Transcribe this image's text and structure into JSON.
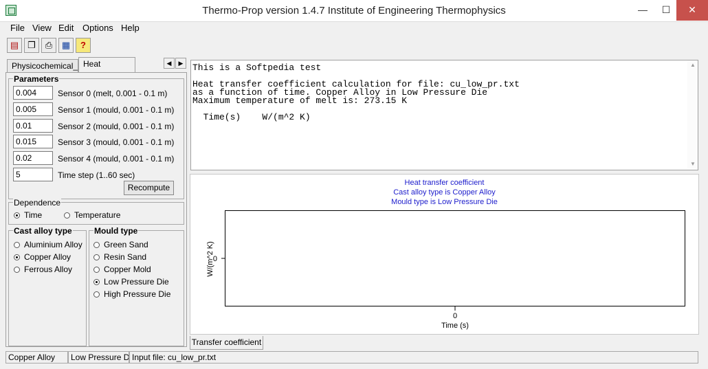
{
  "window": {
    "title": "Thermo-Prop version 1.4.7  Institute of Engineering Thermophysics",
    "minimize_glyph": "—",
    "maximize_glyph": "☐",
    "close_glyph": "✕"
  },
  "menu": [
    "File",
    "View",
    "Edit",
    "Options",
    "Help"
  ],
  "toolbar": {
    "icons": [
      "open-icon",
      "copy-icon",
      "print-icon",
      "table-icon",
      "help-icon"
    ],
    "glyphs": [
      "▤",
      "❐",
      "⎙",
      "▦",
      "?"
    ]
  },
  "tabs": {
    "left": [
      "Physicochemical_B",
      "Heat Transfer"
    ],
    "arrow_left": "◀",
    "arrow_right": "▶",
    "bottom": "Transfer coefficient"
  },
  "parameters": {
    "title": "Parameters",
    "fields": [
      {
        "value": "0.004",
        "label": "Sensor 0 (melt, 0.001 - 0.1 m)"
      },
      {
        "value": "0.005",
        "label": "Sensor 1 (mould, 0.001 - 0.1 m)"
      },
      {
        "value": "0.01",
        "label": "Sensor 2 (mould, 0.001 - 0.1 m)"
      },
      {
        "value": "0.015",
        "label": "Sensor 3 (mould, 0.001 - 0.1 m)"
      },
      {
        "value": "0.02",
        "label": "Sensor 4 (mould, 0.001 - 0.1 m)"
      },
      {
        "value": "5",
        "label": "Time step (1..60 sec)"
      }
    ],
    "recompute_label": "Recompute"
  },
  "dependence": {
    "title": "Dependence",
    "options": [
      "Time",
      "Temperature"
    ],
    "selected": 0
  },
  "cast_alloy": {
    "title": "Cast alloy type",
    "options": [
      "Aluminium Alloy",
      "Copper Alloy",
      "Ferrous Alloy"
    ],
    "selected": 1
  },
  "mould": {
    "title": "Mould type",
    "options": [
      "Green Sand",
      "Resin Sand",
      "Copper Mold",
      "Low Pressure Die",
      "High Pressure Die"
    ],
    "selected": 3
  },
  "output_text": {
    "lines": [
      "This is a Softpedia test",
      "",
      "Heat transfer coefficient calculation for file: cu_low_pr.txt",
      "as a function of time. Copper Alloy in Low Pressure Die",
      "Maximum temperature of melt is: 273.15 K",
      "",
      "  Time(s)    W/(m^2 K)"
    ]
  },
  "chart_data": {
    "type": "line",
    "title": "Heat transfer coefficient",
    "subtitles": [
      "Cast alloy type is Copper Alloy",
      "Mould type is Low Pressure Die"
    ],
    "xlabel": "Time (s)",
    "ylabel": "W/(m^2 K)",
    "x_ticks": [
      "0"
    ],
    "y_ticks": [
      "0"
    ],
    "series": []
  },
  "statusbar": [
    "Copper Alloy",
    "Low Pressure Die",
    "Input file: cu_low_pr.txt"
  ]
}
